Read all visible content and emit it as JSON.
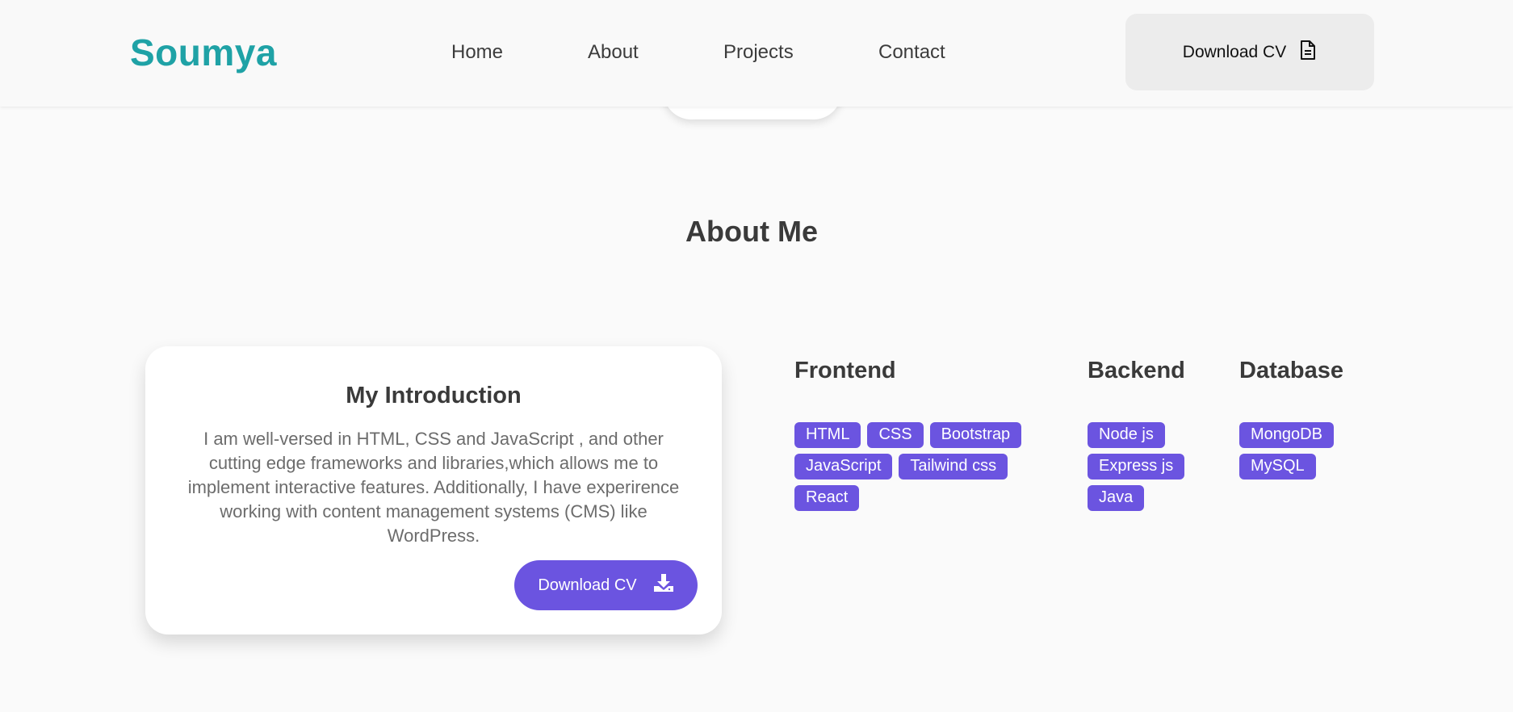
{
  "header": {
    "logo": "Soumya",
    "nav": [
      "Home",
      "About",
      "Projects",
      "Contact"
    ],
    "download_cv": "Download CV",
    "download_cv_icon": "document-icon"
  },
  "about": {
    "title": "About Me",
    "intro": {
      "title": "My Introduction",
      "text": "I am well-versed in HTML, CSS and JavaScript , and other cutting edge frameworks and libraries,which allows me to implement interactive features. Additionally, I have experirence working with content management systems (CMS) like WordPress.",
      "button": "Download CV",
      "button_icon": "download-icon"
    },
    "skills": [
      {
        "title": "Frontend",
        "tags": [
          "HTML",
          "CSS",
          "Bootstrap",
          "JavaScript",
          "Tailwind css",
          "React"
        ]
      },
      {
        "title": "Backend",
        "tags": [
          "Node js",
          "Express js",
          "Java"
        ]
      },
      {
        "title": "Database",
        "tags": [
          "MongoDB",
          "MySQL"
        ]
      }
    ]
  },
  "colors": {
    "brand": "#1fa2a6",
    "accent": "#6b54e0",
    "background": "#fafafa"
  }
}
